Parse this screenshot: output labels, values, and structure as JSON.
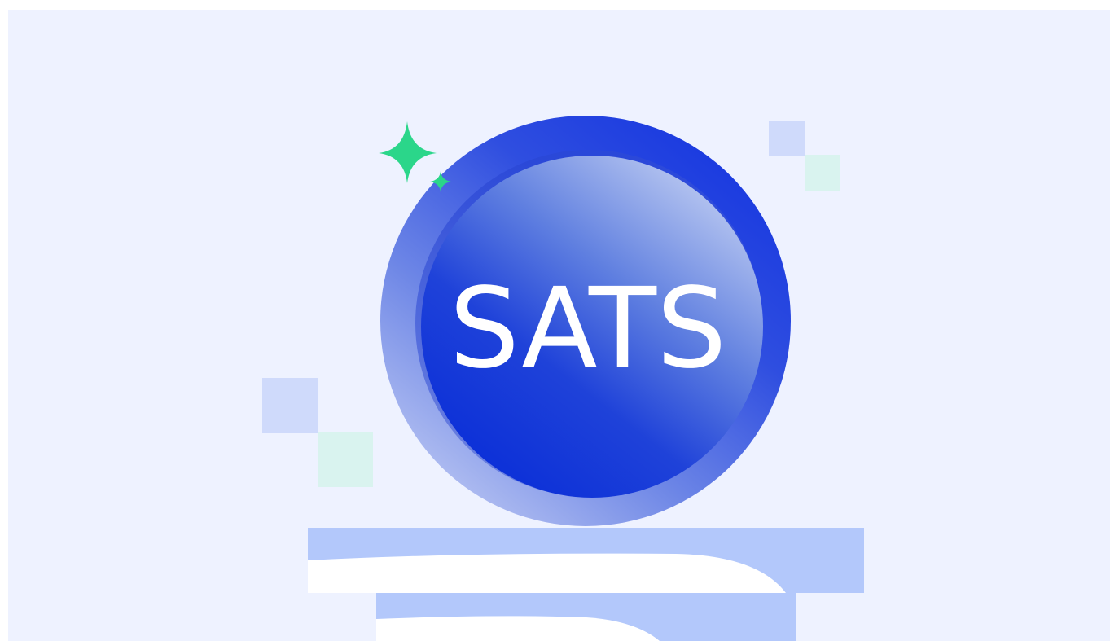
{
  "coin": {
    "label": "SATS"
  },
  "colors": {
    "background": "#eef2ff",
    "coin_outer": "#2a46e0",
    "coin_inner": "#1536d8",
    "sparkle": "#2bd68a",
    "square_blue": "#cfdafb",
    "square_mint": "#d9f3ef",
    "pedestal": "#b3c8fb"
  },
  "icons": {
    "sparkle": "sparkle-icon"
  }
}
